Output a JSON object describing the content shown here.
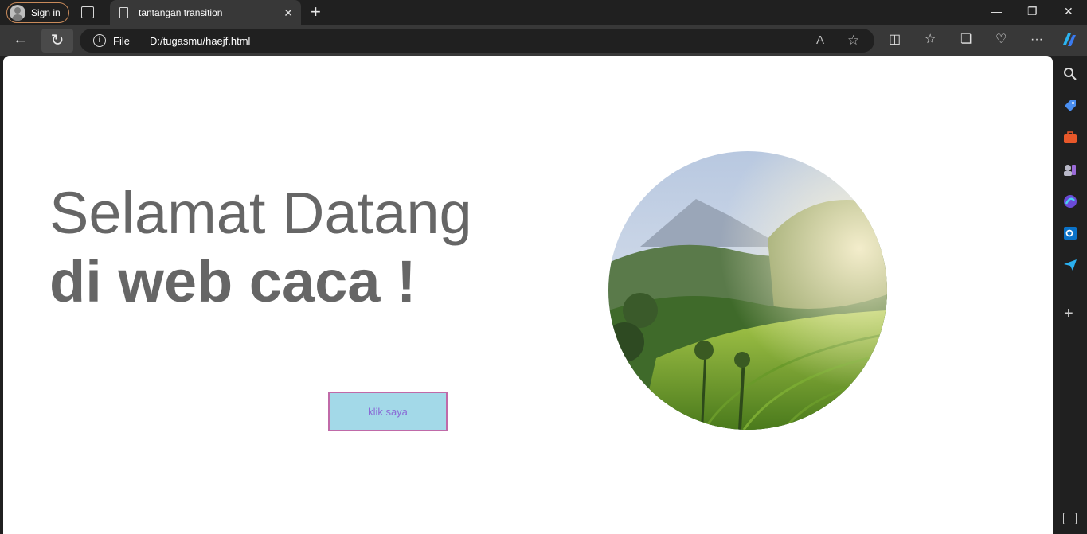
{
  "browser": {
    "signin_label": "Sign in",
    "tab_title": "tantangan transition",
    "address_scheme_label": "File",
    "address_url": "D:/tugasmu/haejf.html"
  },
  "page": {
    "heading_line1": "Selamat Datang",
    "heading_line2": "di web caca !",
    "button_label": "klik saya"
  },
  "icons": {
    "sidebar": [
      "search-icon",
      "tag-icon",
      "toolbox-icon",
      "games-icon",
      "copilot-icon",
      "outlook-icon",
      "send-icon",
      "add-icon",
      "screenshot-icon"
    ]
  },
  "colors": {
    "heading_text": "#666666",
    "button_bg": "#a3d9e8",
    "button_border": "#c06aa8",
    "button_text": "#8a6cd6"
  }
}
